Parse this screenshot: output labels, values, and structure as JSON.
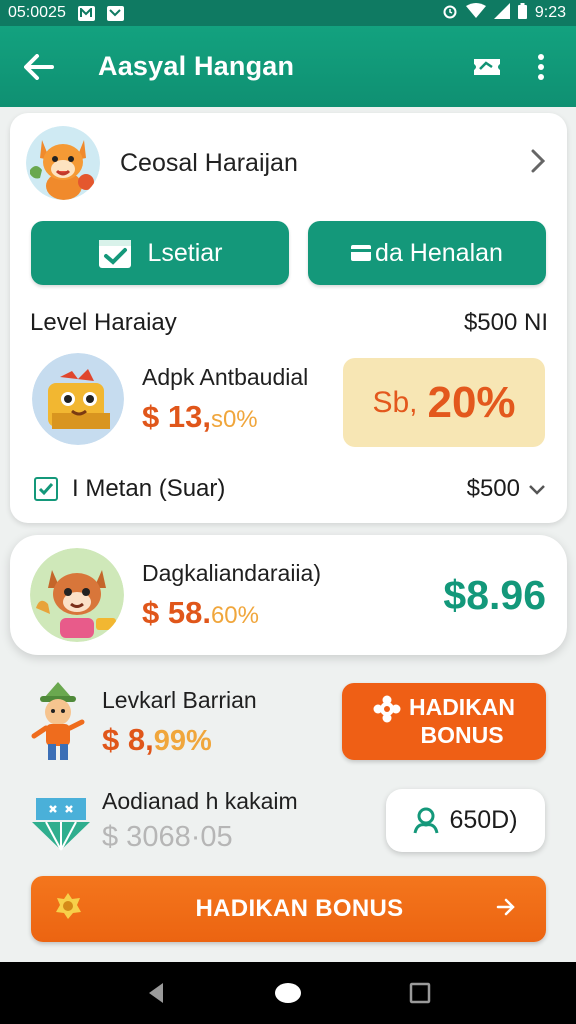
{
  "status_bar": {
    "time_left": "05:0025",
    "time_right": "9:23"
  },
  "app_bar": {
    "title": "Aasyal Hangan"
  },
  "profile": {
    "name": "Ceosal Haraijan"
  },
  "buttons": {
    "left_label": "Lsetiar",
    "right_label": "da Henalan"
  },
  "level": {
    "label": "Level Haraiay",
    "value": "$500 NI"
  },
  "reward": {
    "label": "Adpk Antbaudial",
    "amount_main": "$ 13,",
    "amount_suffix": "s0%",
    "pct_prefix": "Sb,",
    "pct_value": "20%"
  },
  "check_row": {
    "label": "I Metan (Suar)",
    "value": "$500"
  },
  "featured": {
    "label": "Dagkaliandaraiia)",
    "amount_main": "$ 58.",
    "amount_suffix": "60%",
    "value": "$8.96"
  },
  "item1": {
    "label": "Levkarl Barrian",
    "amount_main": "$ 8,",
    "amount_suffix": "99%",
    "button_line1": "HADIKAN",
    "button_line2": "BONUS"
  },
  "item2": {
    "label": "Aodianad h kakaim",
    "amount": "$ 3068·05",
    "pill_value": "650D)"
  },
  "bonus_button": {
    "label": "HADIKAN BONUS"
  },
  "colors": {
    "primary": "#14987a",
    "accent": "#ef5f15",
    "highlight": "#f7e6b4"
  },
  "icons": [
    "back-arrow-icon",
    "ticket-icon",
    "more-vert-icon",
    "chevron-right-icon",
    "calendar-check-icon",
    "checkbox-icon",
    "chevron-down-icon",
    "gear-icon",
    "person-icon",
    "star-badge-icon",
    "arrow-right-icon"
  ]
}
